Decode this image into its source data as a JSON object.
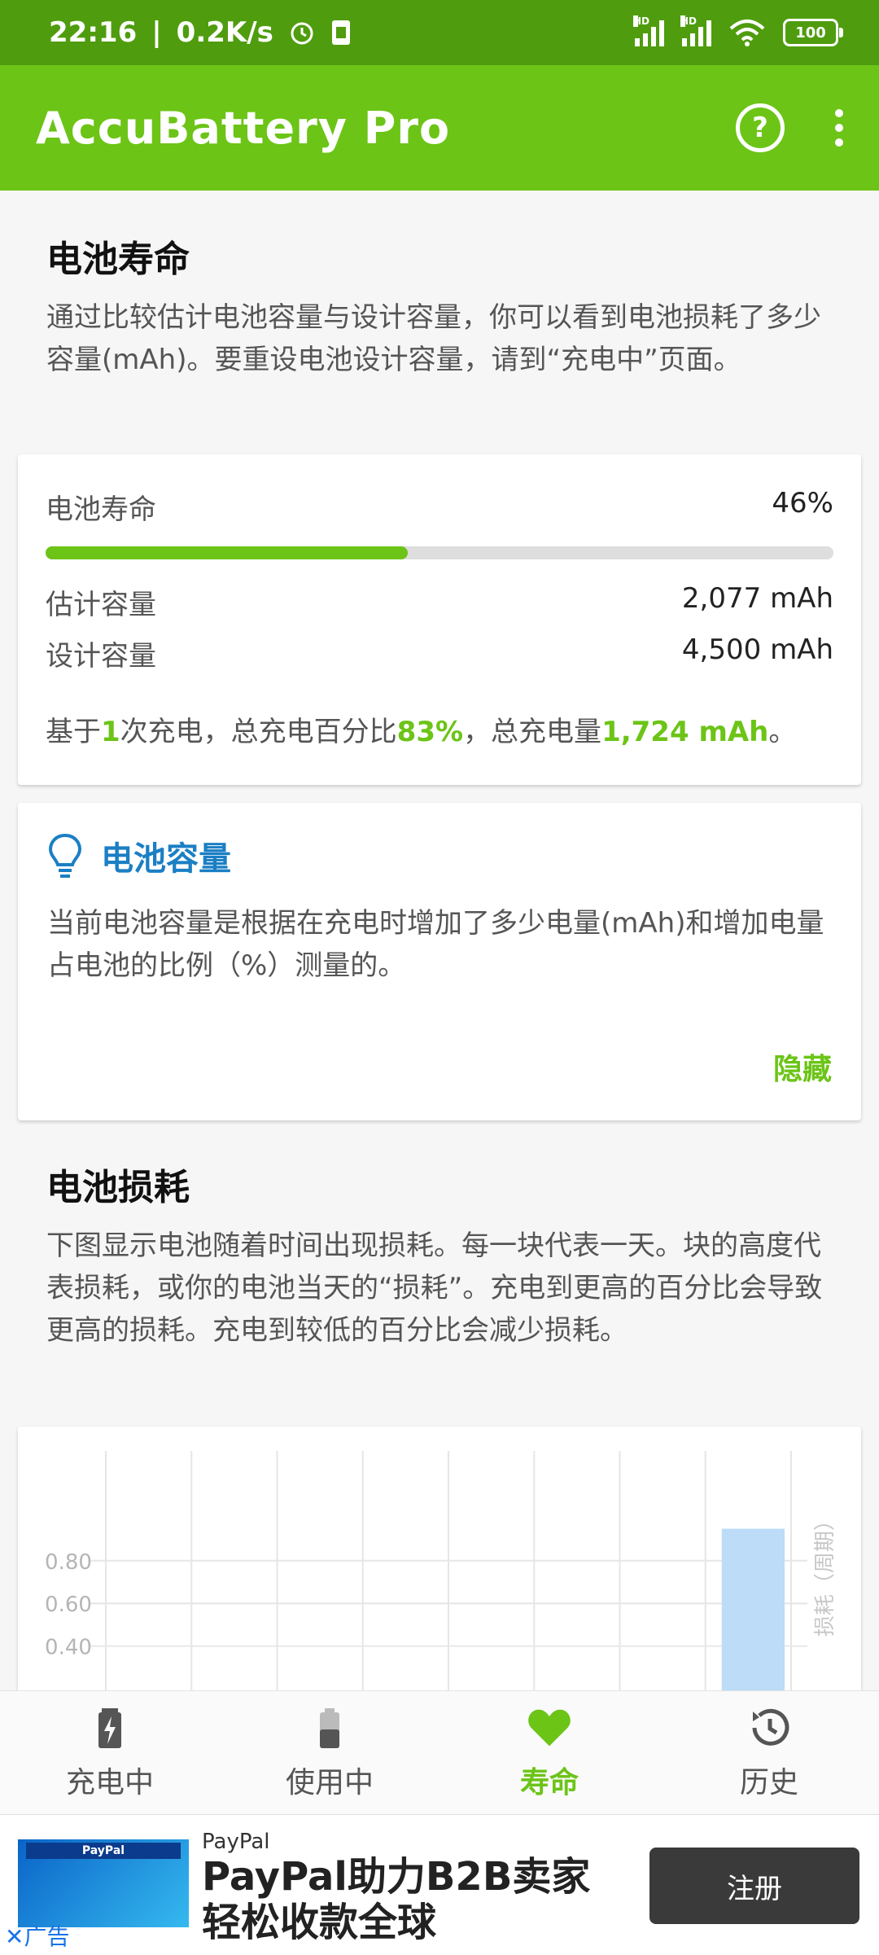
{
  "status_bar": {
    "time": "22:16",
    "speed": "0.2K/s",
    "network1": "HD",
    "network2": "HD",
    "battery": "100"
  },
  "app_bar": {
    "title": "AccuBattery Pro",
    "help_icon": "help-circle-icon",
    "more_icon": "more-vert-icon"
  },
  "health_section": {
    "title": "电池寿命",
    "description": "通过比较估计电池容量与设计容量，你可以看到电池损耗了多少容量(mAh)。要重设电池设计容量，请到“充电中”页面。"
  },
  "health_card": {
    "label": "电池寿命",
    "percent_text": "46%",
    "percent": 46,
    "estimated_label": "估计容量",
    "estimated_value": "2,077 mAh",
    "design_label": "设计容量",
    "design_value": "4,500 mAh",
    "summary_prefix": "基于",
    "summary_count": "1",
    "summary_mid1": "次充电，总充电百分比",
    "summary_pct": "83%",
    "summary_mid2": "，总充电量",
    "summary_mah": "1,724 mAh",
    "summary_end": "。"
  },
  "tip_card": {
    "icon": "lightbulb-icon",
    "title": "电池容量",
    "body": "当前电池容量是根据在充电时增加了多少电量(mAh)和增加电量占电池的比例（%）测量的。",
    "hide_label": "隐藏"
  },
  "wear_section": {
    "title": "电池损耗",
    "description": "下图显示电池随着时间出现损耗。每一块代表一天。块的高度代表损耗，或你的电池当天的“损耗”。充电到更高的百分比会导致更高的损耗。充电到较低的百分比会减少损耗。"
  },
  "chart_data": {
    "type": "bar",
    "ylabel": "损耗（周期）",
    "yticks": [
      0.4,
      0.6,
      0.8
    ],
    "series": [
      {
        "values": [
          0,
          0,
          0,
          0,
          0,
          0,
          0,
          0.95
        ]
      }
    ],
    "bar_color": "#bcdcf7",
    "grid": true
  },
  "bottom_nav": {
    "items": [
      {
        "label": "充电中",
        "icon": "battery-charging-icon",
        "active": false
      },
      {
        "label": "使用中",
        "icon": "battery-icon",
        "active": false
      },
      {
        "label": "寿命",
        "icon": "heart-icon",
        "active": true
      },
      {
        "label": "历史",
        "icon": "history-icon",
        "active": false
      }
    ]
  },
  "ad": {
    "brand": "PayPal",
    "headline": "PayPal助力B2B卖家轻松收款全球",
    "cta": "注册",
    "close_label": "广告",
    "image_logo": "PayPal"
  },
  "colors": {
    "accent": "#6cc417",
    "status_bar": "#4f9d0e",
    "tip_blue": "#1b7fc4"
  }
}
